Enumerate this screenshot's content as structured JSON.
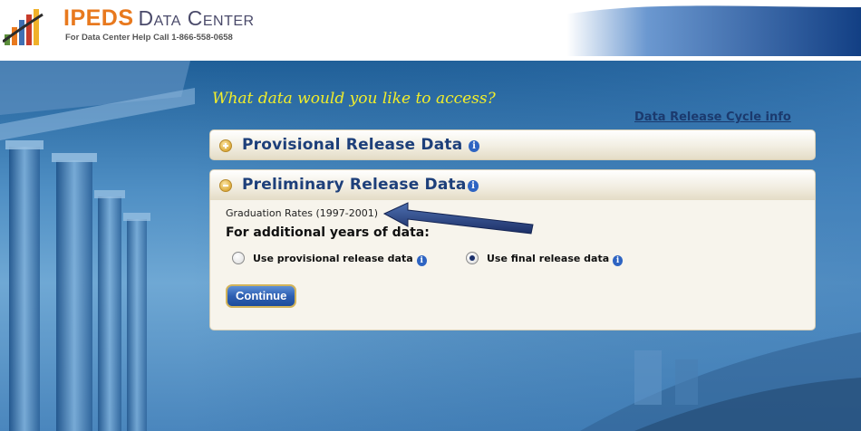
{
  "header": {
    "brand": "IPEDS",
    "product": "Data Center",
    "help_line": "For Data Center Help Call 1-866-558-0658"
  },
  "main": {
    "question": "What data would you like to access?",
    "cycle_link": "Data Release Cycle info",
    "panels": [
      {
        "title": "Provisional Release Data",
        "state": "collapsed"
      },
      {
        "title": "Preliminary Release Data",
        "state": "expanded"
      }
    ],
    "expanded_panel": {
      "item": "Graduation Rates (1997-2001)",
      "additional_label": "For additional years of data:",
      "options": [
        {
          "label": "Use provisional release data",
          "checked": false
        },
        {
          "label": "Use final release data",
          "checked": true
        }
      ],
      "continue_label": "Continue"
    },
    "info_glyph": "i"
  },
  "colors": {
    "brand_orange": "#e8791e",
    "panel_title": "#1d3f7a",
    "question_yellow": "#f2ee2a",
    "link_navy": "#1b3a6e",
    "button_blue": "#2d5fb2"
  },
  "icons": [
    "logo-bars-icon",
    "expand-plus-icon",
    "collapse-minus-icon",
    "info-icon",
    "arrow-pointer-icon"
  ]
}
